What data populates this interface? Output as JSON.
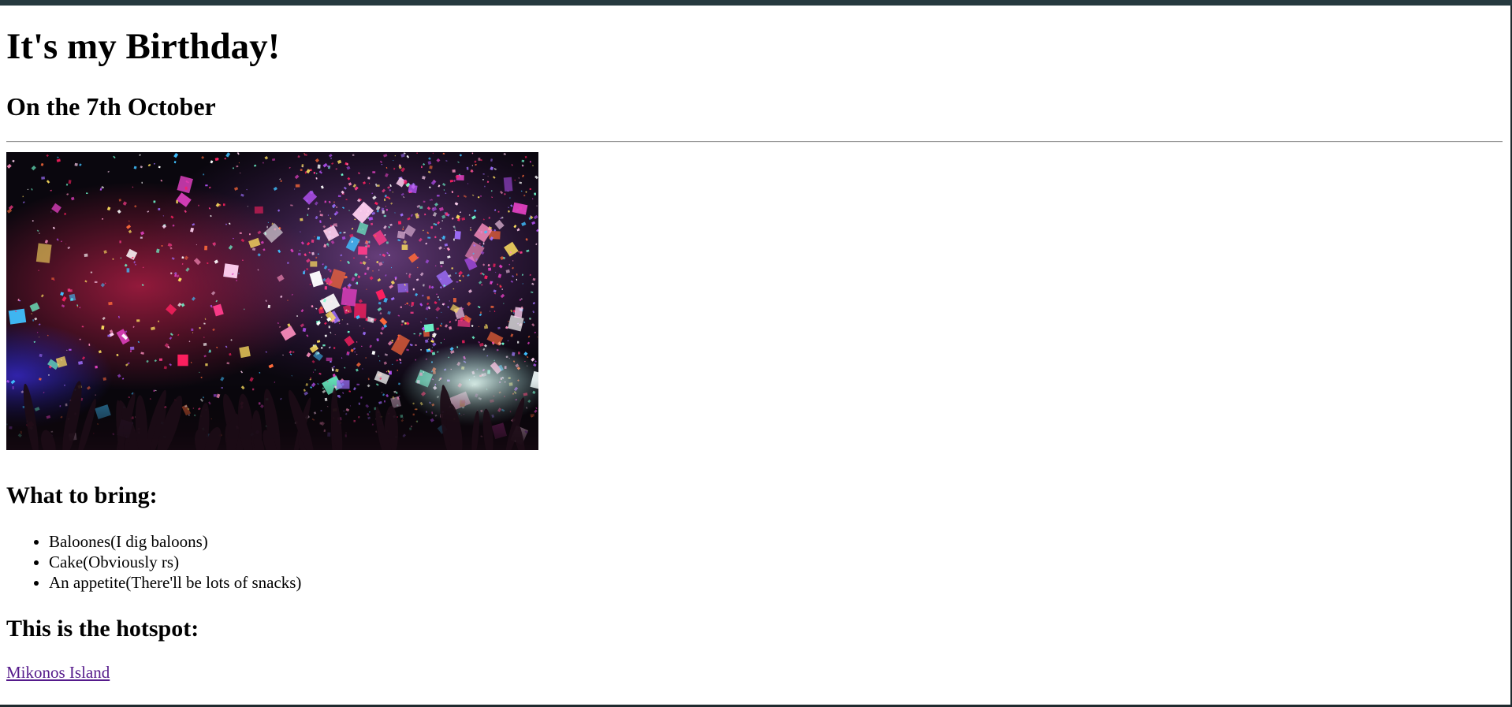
{
  "header": {
    "title": "It's my Birthday!",
    "subtitle": "On the 7th October"
  },
  "hero_image": {
    "alt": "Confetti falling over a concert crowd"
  },
  "bring": {
    "title": "What to bring:",
    "items": [
      "Baloones(I dig baloons)",
      "Cake(Obviously rs)",
      "An appetite(There'll be lots of snacks)"
    ]
  },
  "hotspot": {
    "title": "This is the hotspot:",
    "link_text": "Mikonos Island"
  },
  "colors": {
    "link": "#551a8b",
    "window_bar": "#26393f",
    "divider": "#9a9a9a"
  }
}
